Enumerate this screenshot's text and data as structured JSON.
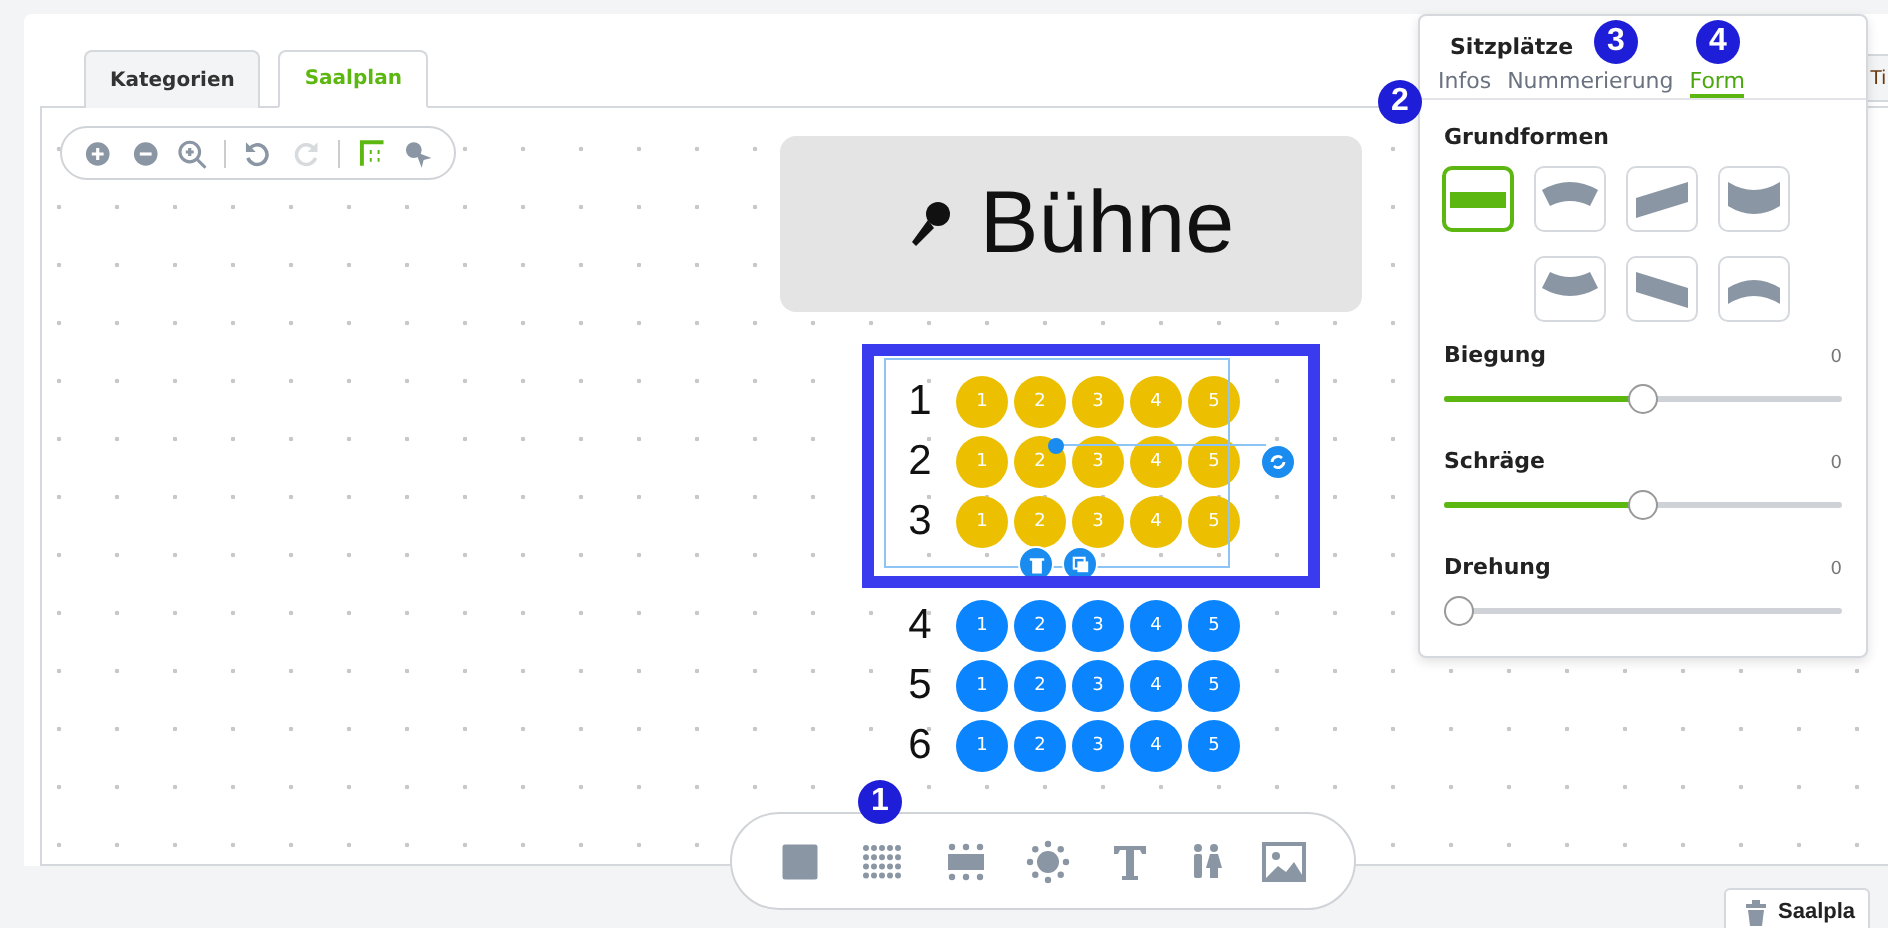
{
  "tabs": [
    {
      "label": "Kategorien",
      "selected": false
    },
    {
      "label": "Saalplan",
      "selected": true
    }
  ],
  "hidden_tab": "Ti",
  "stage": {
    "label": "Bühne"
  },
  "seat_rows": [
    {
      "label": "1",
      "selected": true,
      "seats": [
        "1",
        "2",
        "3",
        "4",
        "5"
      ]
    },
    {
      "label": "2",
      "selected": true,
      "seats": [
        "1",
        "2",
        "3",
        "4",
        "5"
      ]
    },
    {
      "label": "3",
      "selected": true,
      "seats": [
        "1",
        "2",
        "3",
        "4",
        "5"
      ]
    },
    {
      "label": "4",
      "selected": false,
      "seats": [
        "1",
        "2",
        "3",
        "4",
        "5"
      ]
    },
    {
      "label": "5",
      "selected": false,
      "seats": [
        "1",
        "2",
        "3",
        "4",
        "5"
      ]
    },
    {
      "label": "6",
      "selected": false,
      "seats": [
        "1",
        "2",
        "3",
        "4",
        "5"
      ]
    }
  ],
  "panel": {
    "title": "Sitzplätze",
    "tabs": [
      {
        "label": "Infos",
        "selected": false
      },
      {
        "label": "Nummerierung",
        "selected": false
      },
      {
        "label": "Form",
        "selected": true
      }
    ],
    "section": "Grundformen",
    "shapes": [
      {
        "kind": "straight",
        "selected": true
      },
      {
        "kind": "arc-down",
        "selected": false
      },
      {
        "kind": "skew-up",
        "selected": false
      },
      {
        "kind": "bow-down",
        "selected": false
      },
      {
        "kind": "arc-up",
        "selected": false
      },
      {
        "kind": "skew-down",
        "selected": false
      },
      {
        "kind": "bow-up",
        "selected": false
      }
    ],
    "sliders": [
      {
        "label": "Biegung",
        "reading": "0",
        "level": 0.5
      },
      {
        "label": "Schräge",
        "reading": "0",
        "level": 0.5
      },
      {
        "label": "Drehung",
        "reading": "0",
        "level": 0
      }
    ]
  },
  "callouts": [
    "1",
    "2",
    "3",
    "4"
  ],
  "footer_button": "Saalpla"
}
